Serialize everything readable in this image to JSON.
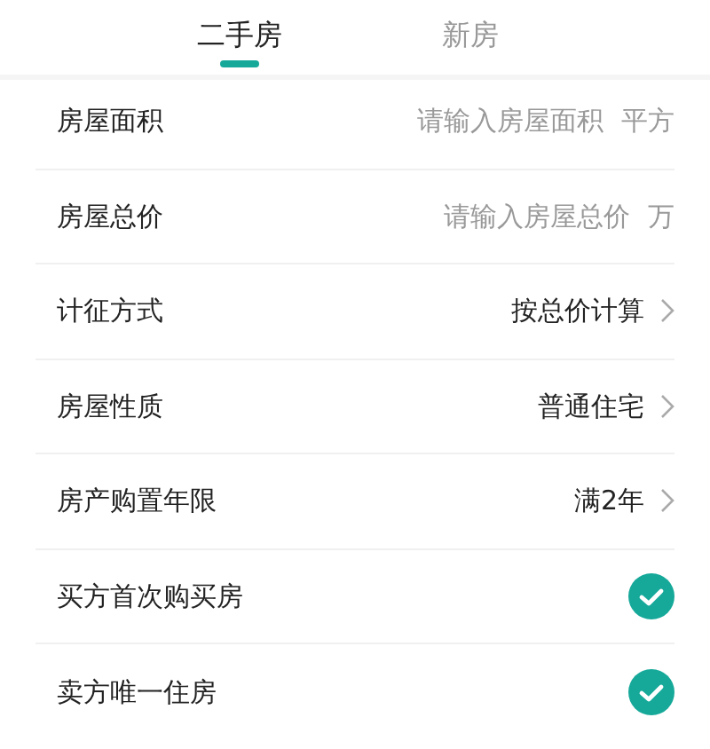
{
  "tabs": [
    {
      "label": "二手房",
      "selected": true
    },
    {
      "label": "新房",
      "selected": false
    }
  ],
  "rows": [
    {
      "kind": "input",
      "label": "房屋面积",
      "placeholder": "请输入房屋面积",
      "unit": "平方"
    },
    {
      "kind": "input",
      "label": "房屋总价",
      "placeholder": "请输入房屋总价",
      "unit": "万"
    },
    {
      "kind": "select",
      "label": "计征方式",
      "value": "按总价计算"
    },
    {
      "kind": "select",
      "label": "房屋性质",
      "value": "普通住宅"
    },
    {
      "kind": "select",
      "label": "房产购置年限",
      "value": "满2年"
    },
    {
      "kind": "check",
      "label": "买方首次购买房",
      "checked": true
    },
    {
      "kind": "check",
      "label": "卖方唯一住房",
      "checked": true
    }
  ]
}
